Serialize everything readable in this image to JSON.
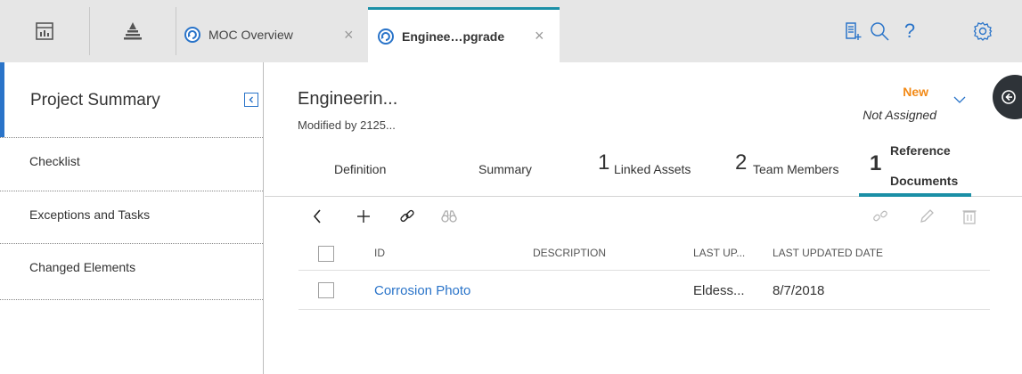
{
  "topbar": {
    "tabs": [
      {
        "label": "MOC Overview",
        "icon": "moc-icon",
        "active": false
      },
      {
        "label": "Enginee…pgrade",
        "icon": "moc-icon",
        "active": true
      }
    ],
    "close_glyph": "×",
    "tools": [
      "new-document-icon",
      "search-icon",
      "help-icon",
      "settings-icon"
    ],
    "help_glyph": "?"
  },
  "left_panel": {
    "title": "Project Summary",
    "items": [
      "Checklist",
      "Exceptions and Tasks",
      "Changed Elements"
    ]
  },
  "record": {
    "title": "Engineerin...",
    "modified": "Modified by 2125...",
    "state": "New",
    "assignee": "Not Assigned"
  },
  "record_tabs": [
    {
      "count": "",
      "label": "Definition"
    },
    {
      "count": "",
      "label": "Summary"
    },
    {
      "count": "1",
      "label": "Linked Assets"
    },
    {
      "count": "2",
      "label": "Team Members"
    },
    {
      "count": "1",
      "label_line1": "Reference",
      "label_line2": "Documents",
      "active": true
    }
  ],
  "grid": {
    "columns": [
      "ID",
      "DESCRIPTION",
      "LAST UP...",
      "LAST UPDATED DATE"
    ],
    "rows": [
      {
        "id": "Corrosion Photo",
        "description": "",
        "last_updated_by": "Eldess...",
        "last_updated_date": "8/7/2018"
      }
    ]
  },
  "colors": {
    "accent": "#1b8fa6",
    "state": "#f28a17",
    "link": "#2a74c9"
  }
}
